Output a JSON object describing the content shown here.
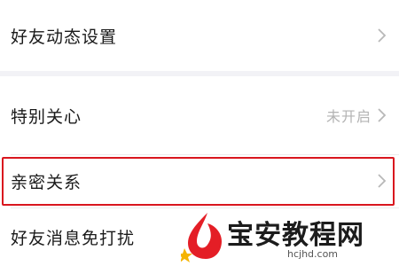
{
  "settings": {
    "friend_feed_settings": {
      "label": "好友动态设置"
    },
    "special_care": {
      "label": "特别关心",
      "status": "未开启"
    },
    "intimate_relationship": {
      "label": "亲密关系"
    },
    "friend_message_mute": {
      "label": "好友消息免打扰"
    }
  },
  "highlight_color": "#d9161e",
  "watermark": {
    "name": "宝安教程网",
    "url": "hcjhd.com"
  },
  "icons": {
    "chevron": "chevron-right-icon"
  }
}
